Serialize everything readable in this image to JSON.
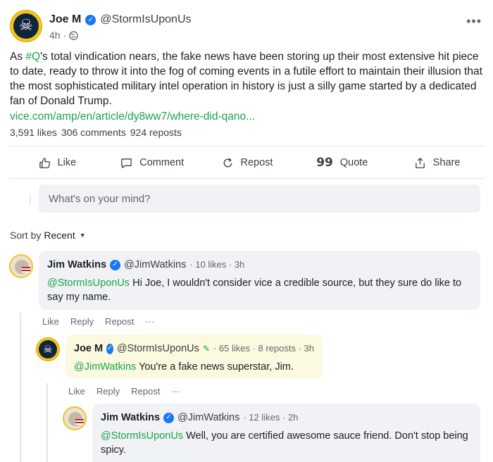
{
  "post": {
    "author_name": "Joe M",
    "author_handle": "@StormIsUponUs",
    "time": "4h",
    "separator": "·",
    "audience_icon": "globe-icon",
    "menu_icon": "more-dots-icon",
    "text_prefix": "As ",
    "hashtag": "#Q",
    "text_body": "'s total vindication nears, the fake news have been storing up their most extensive hit piece to date, ready to throw it into the fog of coming events in a futile effort to maintain their illusion that the most sophisticated military intel operation in history is just a silly game started by a dedicated fan of Donald Trump.",
    "link": "vice.com/amp/en/article/dy8ww7/where-did-qano..."
  },
  "stats": {
    "likes": "3,591 likes",
    "comments": "306 comments",
    "reposts": "924 reposts"
  },
  "actions": [
    {
      "label": "Like",
      "icon": "thumbs-up-icon"
    },
    {
      "label": "Comment",
      "icon": "comment-icon"
    },
    {
      "label": "Repost",
      "icon": "repost-icon"
    },
    {
      "label": "Quote",
      "icon": "quote-icon"
    },
    {
      "label": "Share",
      "icon": "share-icon"
    }
  ],
  "composer": {
    "placeholder": "What's on your mind?"
  },
  "sort": {
    "label": "Sort by",
    "value": "Recent"
  },
  "comments": [
    {
      "name": "Jim Watkins",
      "handle": "@JimWatkins",
      "meta": "· 10 likes · 3h",
      "mention": "@StormIsUponUs",
      "text": " Hi Joe, I wouldn't consider vice a credible source, but they sure do like to say my name.",
      "actions": [
        "Like",
        "Reply",
        "Repost",
        "···"
      ]
    },
    {
      "name": "Joe M",
      "handle": "@StormIsUponUs",
      "meta": "· 65 likes · 8 reposts · 3h",
      "mention": "@JimWatkins",
      "text": " You're a fake news superstar, Jim.",
      "actions": [
        "Like",
        "Reply",
        "Repost",
        "···"
      ]
    },
    {
      "name": "Jim Watkins",
      "handle": "@JimWatkins",
      "meta": "· 12 likes · 2h",
      "mention": "@StormIsUponUs",
      "text": " Well, you are certified awesome sauce friend. Don't stop being spicy."
    }
  ],
  "colors": {
    "accent_green": "#1aa34a",
    "verified_blue": "#1877f2",
    "avatar_ring": "#f5c518"
  }
}
